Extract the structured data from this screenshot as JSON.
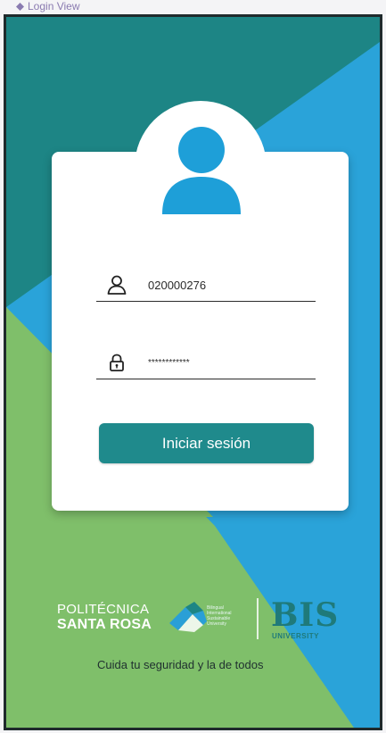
{
  "window": {
    "title": "Login View"
  },
  "login_form": {
    "username_value": "020000276",
    "password_value": "************",
    "submit_label": "Iniciar sesión"
  },
  "branding": {
    "institution_line1": "POLITÉCNICA",
    "institution_line2": "SANTA ROSA",
    "mark_text": "Bilingual International Sustainable University",
    "bis_logo": "BIS",
    "bis_subtitle": "UNIVERSITY",
    "tagline": "Cuida tu seguridad y la de todos"
  },
  "icons": {
    "title": "diamond-icon",
    "avatar": "user-avatar-icon",
    "username": "user-icon",
    "password": "lock-icon"
  },
  "colors": {
    "teal_dark": "#1d8585",
    "sky_blue": "#2aa3d9",
    "green": "#7fbf6a",
    "button": "#1f8a8c",
    "avatar_blue": "#1e9fd8"
  }
}
